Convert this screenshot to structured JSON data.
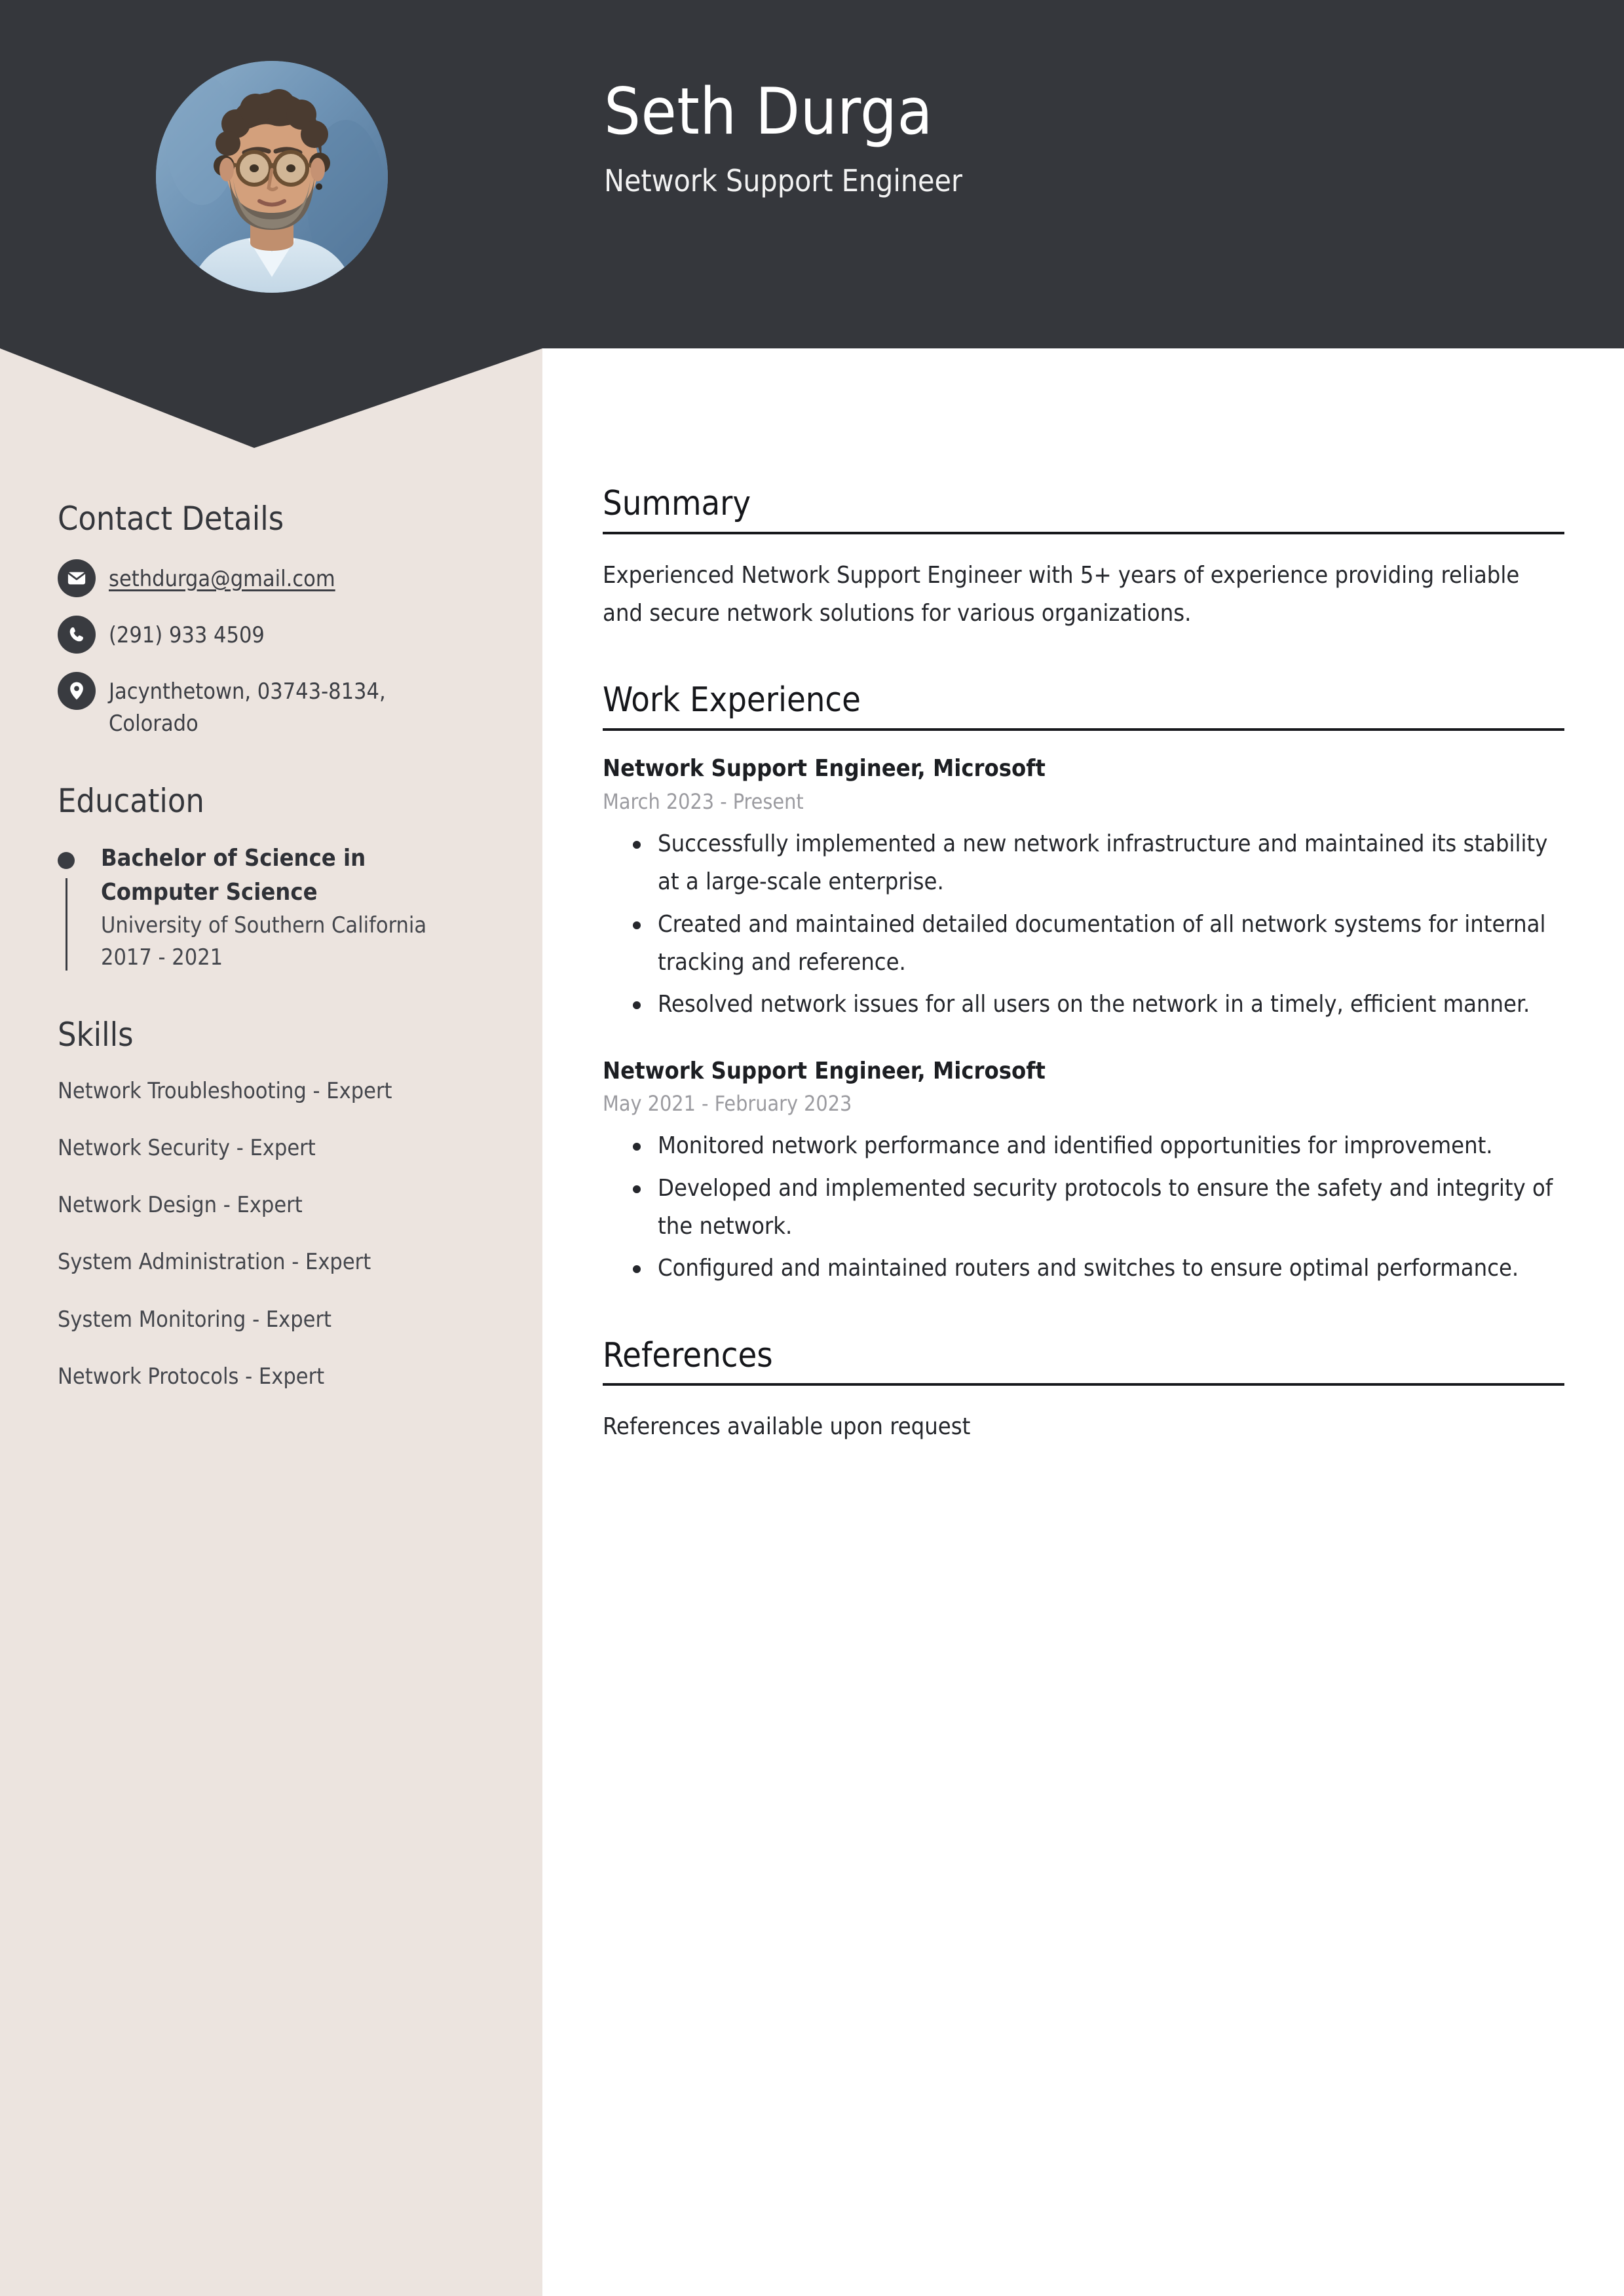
{
  "colors": {
    "header_bg": "#35373c",
    "sidebar_bg": "#ece4df",
    "page_bg": "#ffffff",
    "text_dark": "#25272c",
    "text_muted": "#9b9ba0"
  },
  "header": {
    "name": "Seth Durga",
    "job_title": "Network Support Engineer",
    "avatar_alt": "profile-photo"
  },
  "sidebar": {
    "contact": {
      "heading": "Contact Details",
      "items": [
        {
          "icon": "envelope-icon",
          "value": "sethdurga@gmail.com",
          "is_link": true
        },
        {
          "icon": "phone-icon",
          "value": "(291) 933 4509",
          "is_link": false
        },
        {
          "icon": "location-pin-icon",
          "value": "Jacynthetown, 03743-8134, Colorado",
          "is_link": false
        }
      ]
    },
    "education": {
      "heading": "Education",
      "items": [
        {
          "degree": "Bachelor of Science in Computer Science",
          "school": "University of Southern California",
          "years": "2017 - 2021"
        }
      ]
    },
    "skills": {
      "heading": "Skills",
      "items": [
        "Network Troubleshooting - Expert",
        "Network Security - Expert",
        "Network Design - Expert",
        "System Administration - Expert",
        "System Monitoring - Expert",
        "Network Protocols - Expert"
      ]
    }
  },
  "main": {
    "summary": {
      "heading": "Summary",
      "text": "Experienced Network Support Engineer with 5+ years of experience providing reliable and secure network solutions for various organizations."
    },
    "work_experience": {
      "heading": "Work Experience",
      "jobs": [
        {
          "role": "Network Support Engineer, Microsoft",
          "dates": "March 2023 - Present",
          "bullets": [
            "Successfully implemented a new network infrastructure and maintained its stability at a large-scale enterprise.",
            "Created and maintained detailed documentation of all network systems for internal tracking and reference.",
            "Resolved network issues for all users on the network in a timely, efficient manner."
          ]
        },
        {
          "role": "Network Support Engineer, Microsoft",
          "dates": "May 2021 - February 2023",
          "bullets": [
            "Monitored network performance and identified opportunities for improvement.",
            "Developed and implemented security protocols to ensure the safety and integrity of the network.",
            "Configured and maintained routers and switches to ensure optimal performance."
          ]
        }
      ]
    },
    "references": {
      "heading": "References",
      "text": "References available upon request"
    }
  }
}
